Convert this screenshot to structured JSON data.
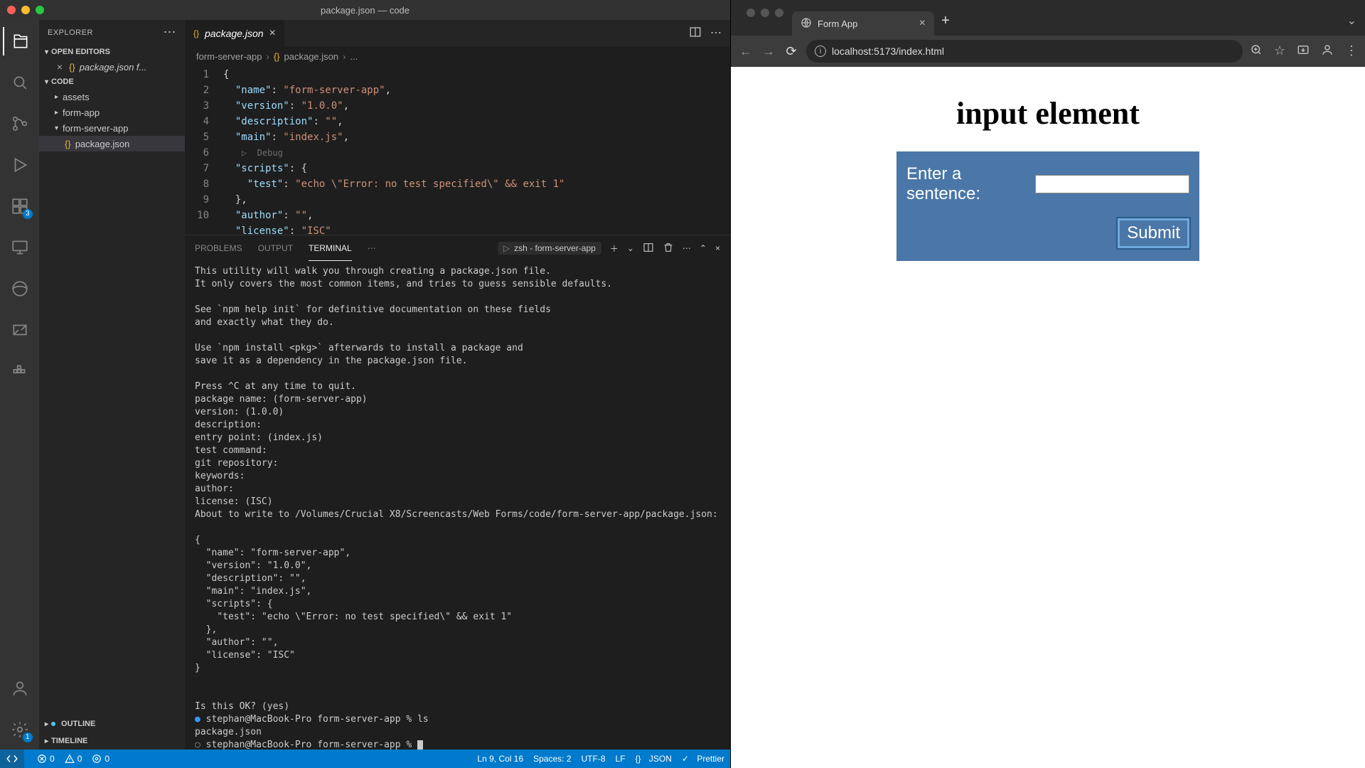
{
  "vscode": {
    "titlebar": "package.json — code",
    "explorer": {
      "title": "EXPLORER",
      "sections": {
        "open_editors": "OPEN EDITORS",
        "open_editor_item": "package.json  f...",
        "workspace": "CODE",
        "outline": "OUTLINE",
        "timeline": "TIMELINE"
      },
      "tree": {
        "assets": "assets",
        "form_app": "form-app",
        "form_server_app": "form-server-app",
        "package_json": "package.json"
      }
    },
    "activity_badges": {
      "ext": "3",
      "settings": "1"
    },
    "tab": {
      "label": "package.json",
      "icon": "{}"
    },
    "breadcrumbs": {
      "folder": "form-server-app",
      "file": "package.json",
      "ellipsis": "...",
      "file_icon": "{}"
    },
    "debug_hint": "▷  Debug",
    "code": {
      "lines": [
        "{",
        "  \"name\": \"form-server-app\",",
        "  \"version\": \"1.0.0\",",
        "  \"description\": \"\",",
        "  \"main\": \"index.js\",",
        "  \"scripts\": {",
        "    \"test\": \"echo \\\"Error: no test specified\\\" && exit 1\"",
        "  },",
        "  \"author\": \"\",",
        "  \"license\": \"ISC\""
      ],
      "line_numbers": [
        "1",
        "2",
        "3",
        "4",
        "5",
        "6",
        "7",
        "8",
        "9",
        "10"
      ]
    },
    "panel": {
      "tabs": {
        "problems": "PROBLEMS",
        "output": "OUTPUT",
        "terminal": "TERMINAL"
      },
      "term_chip": "zsh - form-server-app",
      "terminal_text": "This utility will walk you through creating a package.json file.\nIt only covers the most common items, and tries to guess sensible defaults.\n\nSee `npm help init` for definitive documentation on these fields\nand exactly what they do.\n\nUse `npm install <pkg>` afterwards to install a package and\nsave it as a dependency in the package.json file.\n\nPress ^C at any time to quit.\npackage name: (form-server-app)\nversion: (1.0.0)\ndescription:\nentry point: (index.js)\ntest command:\ngit repository:\nkeywords:\nauthor:\nlicense: (ISC)\nAbout to write to /Volumes/Crucial X8/Screencasts/Web Forms/code/form-server-app/package.json:\n\n{\n  \"name\": \"form-server-app\",\n  \"version\": \"1.0.0\",\n  \"description\": \"\",\n  \"main\": \"index.js\",\n  \"scripts\": {\n    \"test\": \"echo \\\"Error: no test specified\\\" && exit 1\"\n  },\n  \"author\": \"\",\n  \"license\": \"ISC\"\n}\n\n\nIs this OK? (yes)",
      "prompt1_pre": "● ",
      "prompt1": "stephan@MacBook-Pro form-server-app % ",
      "prompt1_cmd": "ls",
      "prompt1_out": "package.json",
      "prompt2_pre": "○ ",
      "prompt2": "stephan@MacBook-Pro form-server-app % "
    },
    "statusbar": {
      "errors": "0",
      "warnings": "0",
      "ports_label": "0",
      "ln_col": "Ln 9, Col 16",
      "spaces": "Spaces: 2",
      "enc": "UTF-8",
      "eol": "LF",
      "lang_icon": "{}",
      "lang": "JSON",
      "prettier": "Prettier",
      "prettier_icon": "✓"
    }
  },
  "browser": {
    "tab_title": "Form App",
    "url": "localhost:5173/index.html",
    "page": {
      "heading": "input element",
      "label": "Enter a sentence:",
      "submit": "Submit"
    }
  }
}
